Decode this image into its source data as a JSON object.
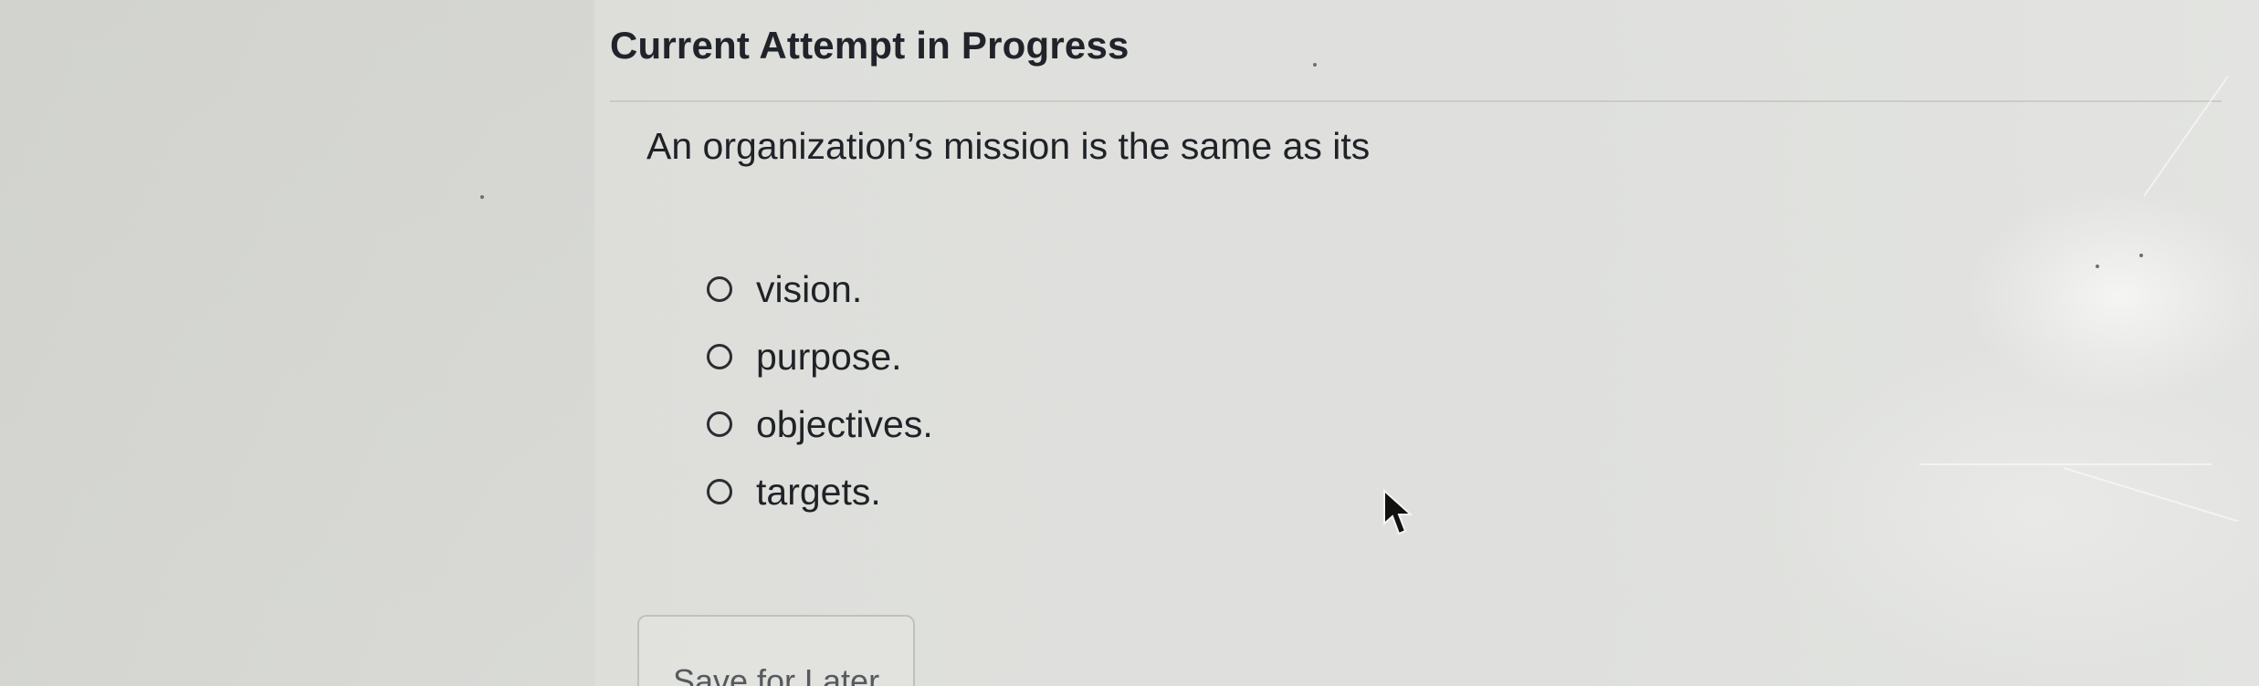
{
  "page": {
    "title": "Current Attempt in Progress"
  },
  "question": {
    "prompt": "An organization’s mission is the same as its",
    "options": [
      {
        "label": "vision.",
        "selected": false
      },
      {
        "label": "purpose.",
        "selected": false
      },
      {
        "label": "objectives.",
        "selected": false
      },
      {
        "label": "targets.",
        "selected": false
      }
    ]
  },
  "actions": {
    "save_label": "Save for Later"
  },
  "icons": {
    "radio": "radio-button-icon",
    "cursor": "mouse-pointer-icon"
  },
  "colors": {
    "text": "#1f2226",
    "button_text": "#555a5f",
    "button_border": "#bfc1bd",
    "background": "#dcdedb"
  }
}
